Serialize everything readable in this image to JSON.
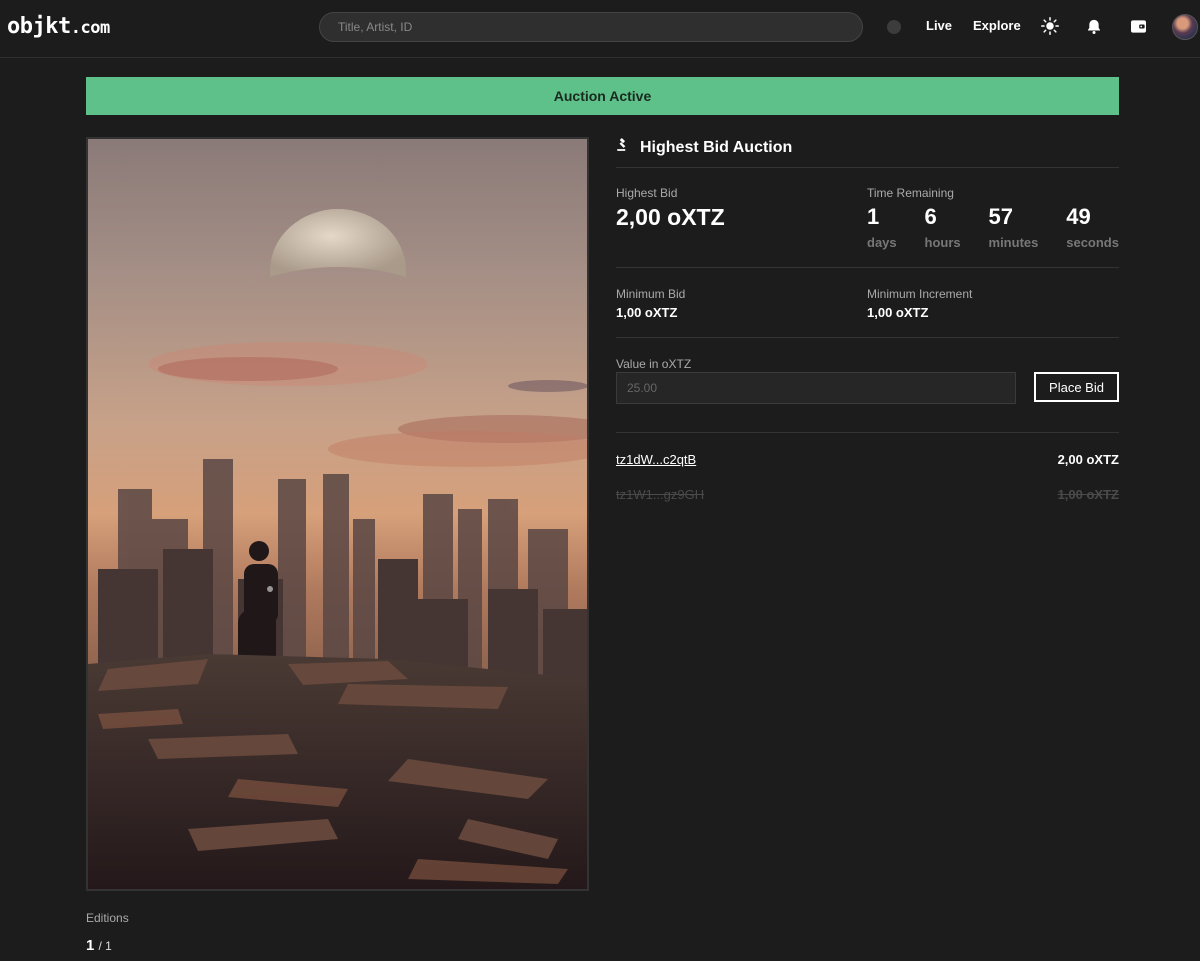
{
  "header": {
    "logo_main": "objkt",
    "logo_domain": ".com",
    "search_placeholder": "Title, Artist, ID",
    "nav": {
      "live": "Live",
      "explore": "Explore"
    },
    "icons": [
      "sun-icon",
      "bell-icon",
      "wallet-icon",
      "avatar"
    ]
  },
  "banner": {
    "text": "Auction Active",
    "color": "#5fc18a"
  },
  "auction": {
    "title": "Highest Bid Auction",
    "highest_bid_label": "Highest Bid",
    "highest_bid_value": "2,00 oXTZ",
    "time_remaining_label": "Time Remaining",
    "time": [
      {
        "value": "1",
        "unit": "days"
      },
      {
        "value": "6",
        "unit": "hours"
      },
      {
        "value": "57",
        "unit": "minutes"
      },
      {
        "value": "49",
        "unit": "seconds"
      }
    ],
    "minimum_bid_label": "Minimum Bid",
    "minimum_bid_value": "1,00 oXTZ",
    "minimum_increment_label": "Minimum Increment",
    "minimum_increment_value": "1,00 oXTZ",
    "value_label": "Value in oXTZ",
    "value_placeholder": "25.00",
    "place_bid_label": "Place Bid"
  },
  "bids": [
    {
      "address": "tz1dW...c2qtB",
      "amount": "2,00 oXTZ",
      "outbid": false
    },
    {
      "address": "tz1W1...gz9GH",
      "amount": "1,00 oXTZ",
      "outbid": true
    }
  ],
  "editions": {
    "label": "Editions",
    "current": "1",
    "total": "/ 1"
  }
}
